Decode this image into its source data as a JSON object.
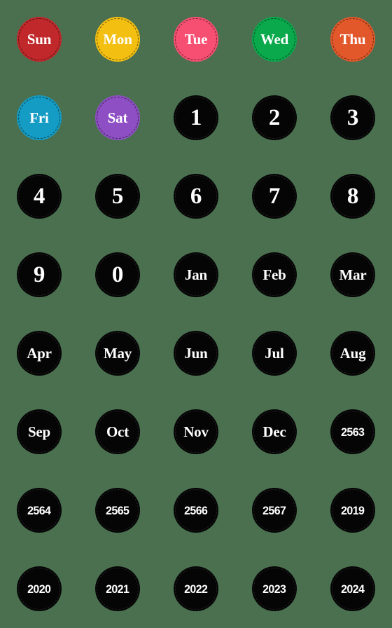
{
  "sheet": {
    "background_color": "#4a7050",
    "columns": 5,
    "rows": 8,
    "sticker_shape": "circle",
    "text_color": "#ffffff"
  },
  "stickers": [
    {
      "label": "Sun",
      "kind": "day",
      "bg": "#c0282b",
      "ring": "dark"
    },
    {
      "label": "Mon",
      "kind": "day",
      "bg": "#f3bf11",
      "ring": "dark"
    },
    {
      "label": "Tue",
      "kind": "day",
      "bg": "#f74f72",
      "ring": "dark"
    },
    {
      "label": "Wed",
      "kind": "day",
      "bg": "#09a94c",
      "ring": "dark"
    },
    {
      "label": "Thu",
      "kind": "day",
      "bg": "#e2582b",
      "ring": "dark"
    },
    {
      "label": "Fri",
      "kind": "day",
      "bg": "#149cc4",
      "ring": "dark"
    },
    {
      "label": "Sat",
      "kind": "day",
      "bg": "#8e4fc4",
      "ring": "dark"
    },
    {
      "label": "1",
      "kind": "digit",
      "bg": "#050505",
      "ring": "light"
    },
    {
      "label": "2",
      "kind": "digit",
      "bg": "#050505",
      "ring": "light"
    },
    {
      "label": "3",
      "kind": "digit",
      "bg": "#050505",
      "ring": "light"
    },
    {
      "label": "4",
      "kind": "digit",
      "bg": "#050505",
      "ring": "light"
    },
    {
      "label": "5",
      "kind": "digit",
      "bg": "#050505",
      "ring": "light"
    },
    {
      "label": "6",
      "kind": "digit",
      "bg": "#050505",
      "ring": "light"
    },
    {
      "label": "7",
      "kind": "digit",
      "bg": "#050505",
      "ring": "light"
    },
    {
      "label": "8",
      "kind": "digit",
      "bg": "#050505",
      "ring": "light"
    },
    {
      "label": "9",
      "kind": "digit",
      "bg": "#050505",
      "ring": "light"
    },
    {
      "label": "0",
      "kind": "digit",
      "bg": "#050505",
      "ring": "light"
    },
    {
      "label": "Jan",
      "kind": "month",
      "bg": "#050505",
      "ring": "light"
    },
    {
      "label": "Feb",
      "kind": "month",
      "bg": "#050505",
      "ring": "light"
    },
    {
      "label": "Mar",
      "kind": "month",
      "bg": "#050505",
      "ring": "light"
    },
    {
      "label": "Apr",
      "kind": "month",
      "bg": "#050505",
      "ring": "light"
    },
    {
      "label": "May",
      "kind": "month",
      "bg": "#050505",
      "ring": "light"
    },
    {
      "label": "Jun",
      "kind": "month",
      "bg": "#050505",
      "ring": "light"
    },
    {
      "label": "Jul",
      "kind": "month",
      "bg": "#050505",
      "ring": "light"
    },
    {
      "label": "Aug",
      "kind": "month",
      "bg": "#050505",
      "ring": "light"
    },
    {
      "label": "Sep",
      "kind": "month",
      "bg": "#050505",
      "ring": "light"
    },
    {
      "label": "Oct",
      "kind": "month",
      "bg": "#050505",
      "ring": "light"
    },
    {
      "label": "Nov",
      "kind": "month",
      "bg": "#050505",
      "ring": "light"
    },
    {
      "label": "Dec",
      "kind": "month",
      "bg": "#050505",
      "ring": "light"
    },
    {
      "label": "2563",
      "kind": "year",
      "bg": "#050505",
      "ring": "light"
    },
    {
      "label": "2564",
      "kind": "year",
      "bg": "#050505",
      "ring": "light"
    },
    {
      "label": "2565",
      "kind": "year",
      "bg": "#050505",
      "ring": "light"
    },
    {
      "label": "2566",
      "kind": "year",
      "bg": "#050505",
      "ring": "light"
    },
    {
      "label": "2567",
      "kind": "year",
      "bg": "#050505",
      "ring": "light"
    },
    {
      "label": "2019",
      "kind": "year",
      "bg": "#050505",
      "ring": "light"
    },
    {
      "label": "2020",
      "kind": "year",
      "bg": "#050505",
      "ring": "light"
    },
    {
      "label": "2021",
      "kind": "year",
      "bg": "#050505",
      "ring": "light"
    },
    {
      "label": "2022",
      "kind": "year",
      "bg": "#050505",
      "ring": "light"
    },
    {
      "label": "2023",
      "kind": "year",
      "bg": "#050505",
      "ring": "light"
    },
    {
      "label": "2024",
      "kind": "year",
      "bg": "#050505",
      "ring": "light"
    }
  ]
}
